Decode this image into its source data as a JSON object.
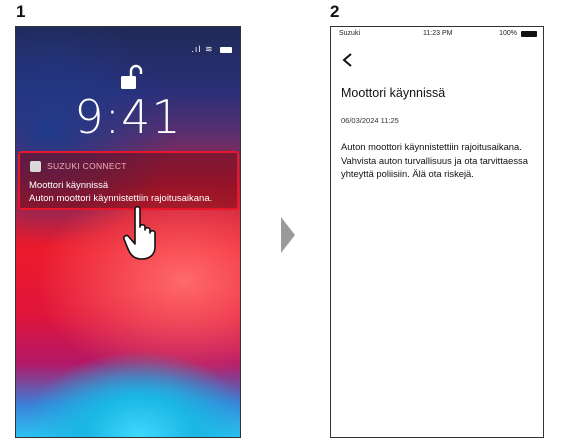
{
  "steps": {
    "first": "1",
    "second": "2"
  },
  "lock_screen": {
    "time": "9:41",
    "notification": {
      "app_name": "SUZUKI CONNECT",
      "title": "Moottori käynnissä",
      "body": "Auton moottori käynnistettiin rajoitusaikana."
    }
  },
  "app_screen": {
    "status_bar": {
      "carrier": "Suzuki",
      "time": "11:23 PM",
      "battery": "100%"
    },
    "title": "Moottori käynnissä",
    "date": "06/03/2024 11:25",
    "message": "Auton moottori käynnistettiin rajoitusaikana. Vahvista auton turvallisuus ja ota tarvittaessa yhteyttä poliisiin. Älä ota riskejä."
  },
  "colors": {
    "notification_highlight": "#e6172d",
    "arrow": "#9a9a9a"
  }
}
